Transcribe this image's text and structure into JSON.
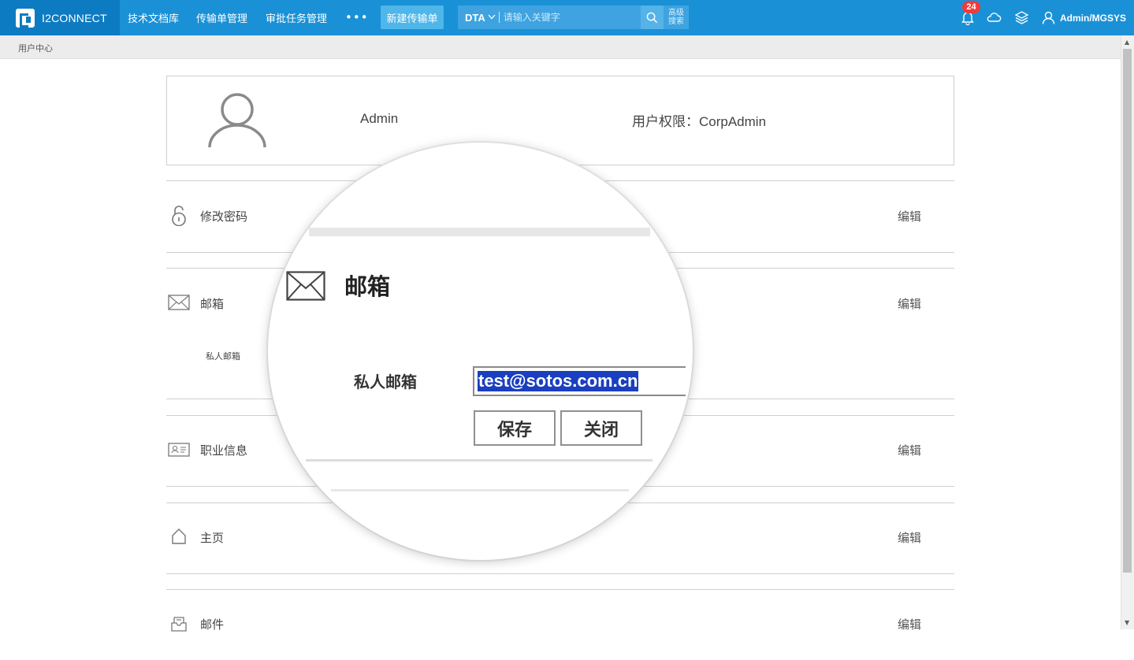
{
  "app": {
    "name": "I2CONNECT"
  },
  "nav": {
    "items": [
      "技术文档库",
      "传输单管理",
      "审批任务管理"
    ],
    "more": "•••",
    "new_button": "新建传输单"
  },
  "search": {
    "scope": "DTA",
    "placeholder": "请输入关键字",
    "advanced_line1": "高级",
    "advanced_line2": "搜索"
  },
  "notifications": {
    "count": "24"
  },
  "user": {
    "name": "Admin/MGSYS"
  },
  "breadcrumb": {
    "current": "用户中心"
  },
  "profile": {
    "name": "Admin",
    "role_label": "用户权限：",
    "role_value": "CorpAdmin"
  },
  "sections": [
    {
      "title": "修改密码",
      "edit": "编辑"
    },
    {
      "title": "邮箱",
      "edit": "编辑",
      "sub_label": "私人邮箱"
    },
    {
      "title": "职业信息",
      "edit": "编辑"
    },
    {
      "title": "主页",
      "edit": "编辑"
    },
    {
      "title": "邮件",
      "edit": "编辑"
    }
  ],
  "magnifier": {
    "title": "邮箱",
    "field_label": "私人邮箱",
    "email_value": "test@sotos.com.cn",
    "save": "保存",
    "close": "关闭"
  },
  "colors": {
    "topbar": "#1a91d6",
    "brand": "#0d7bc2",
    "badge": "#f23a3a",
    "selection": "#1a3fbf"
  }
}
